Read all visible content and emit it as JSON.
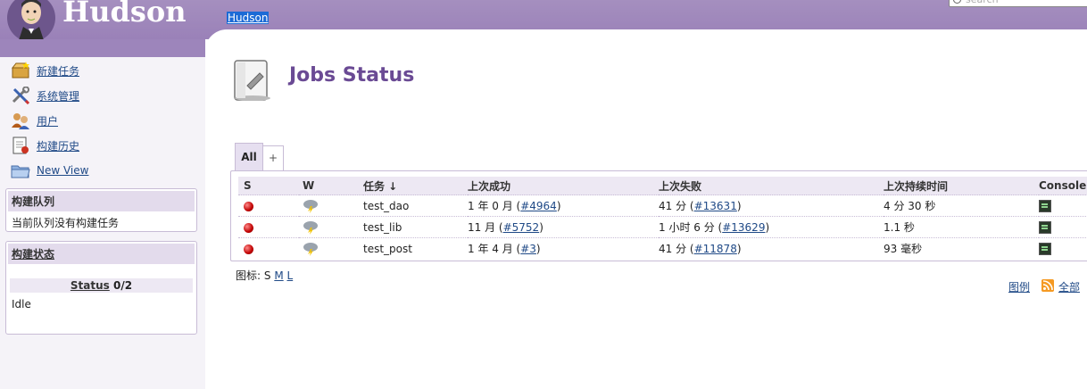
{
  "header": {
    "brand": "Hudson",
    "breadcrumb": "Hudson",
    "search_placeholder": "search"
  },
  "sidebar": {
    "tasks": [
      {
        "label": "新建任务",
        "icon": "new-package-icon"
      },
      {
        "label": "系统管理",
        "icon": "wrench-screwdriver-icon"
      },
      {
        "label": "用户",
        "icon": "users-icon"
      },
      {
        "label": "构建历史",
        "icon": "notepad-history-icon"
      },
      {
        "label": "New View",
        "icon": "folder-icon"
      }
    ],
    "queue": {
      "title": "构建队列",
      "text": "当前队列没有构建任务"
    },
    "executors": {
      "title": "构建状态",
      "status_label": "Status",
      "status_count": "0/2",
      "idle": "Idle"
    }
  },
  "main": {
    "title": "Jobs Status",
    "tabs": [
      {
        "label": "All"
      },
      {
        "label": "+"
      }
    ],
    "columns": {
      "s": "S",
      "w": "W",
      "name": "任务 ↓",
      "last_success": "上次成功",
      "last_failure": "上次失败",
      "last_duration": "上次持续时间",
      "console": "Console"
    },
    "jobs": [
      {
        "name": "test_dao",
        "success_text": "1 年 0 月 (",
        "success_build": "#4964",
        "failure_text": "41 分 (",
        "failure_build": "#13631",
        "duration": "4 分 30 秒"
      },
      {
        "name": "test_lib",
        "success_text": "11 月 (",
        "success_build": "#5752",
        "failure_text": "1 小时 6 分 (",
        "failure_build": "#13629",
        "duration": "1.1 秒"
      },
      {
        "name": "test_post",
        "success_text": "1 年 4 月 (",
        "success_build": "#3",
        "failure_text": "41 分 (",
        "failure_build": "#11878",
        "duration": "93 毫秒"
      }
    ],
    "close_paren": ")",
    "icon_sizes_label": "图标: ",
    "icon_sizes": [
      "S",
      "M",
      "L"
    ],
    "legend": "图例",
    "rss_all": "全部"
  },
  "colors": {
    "header": "#9d85bb",
    "title": "#6a4a94",
    "failed_ball": "#c00000"
  }
}
